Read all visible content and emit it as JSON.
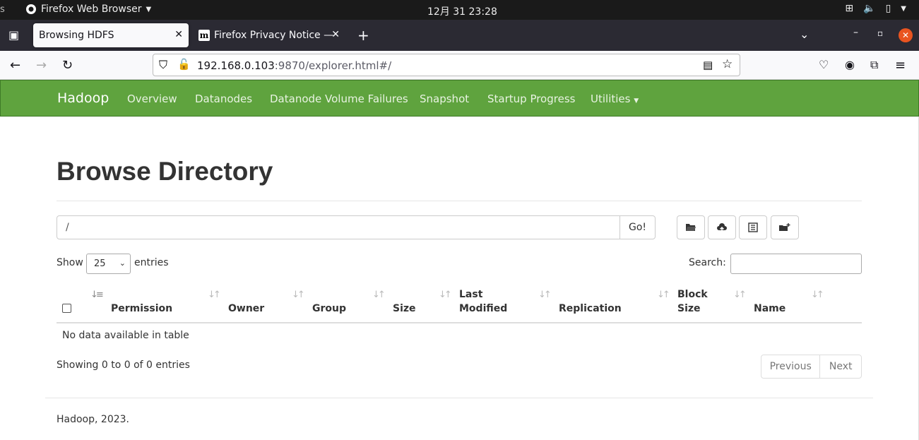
{
  "os": {
    "app_name": "Firefox Web Browser",
    "clock": "12月 31  23:28",
    "left_mark": "s"
  },
  "browser": {
    "tabs": [
      {
        "label": "Browsing HDFS"
      },
      {
        "label": "Firefox Privacy Notice —"
      }
    ],
    "url_host": "192.168.0.103",
    "url_rest": ":9870/explorer.html#/"
  },
  "hadoop_nav": {
    "brand": "Hadoop",
    "links": [
      "Overview",
      "Datanodes",
      "Datanode Volume Failures",
      "Snapshot",
      "Startup Progress",
      "Utilities"
    ]
  },
  "page": {
    "title": "Browse Directory",
    "path_value": "/",
    "go_label": "Go!",
    "show_label": "Show",
    "entries_value": "25",
    "entries_label": "entries",
    "search_label": "Search:",
    "columns": {
      "permission": "Permission",
      "owner": "Owner",
      "group": "Group",
      "size": "Size",
      "last_modified_1": "Last",
      "last_modified_2": "Modified",
      "replication": "Replication",
      "block_size_1": "Block",
      "block_size_2": "Size",
      "name": "Name"
    },
    "no_data": "No data available in table",
    "showing": "Showing 0 to 0 of 0 entries",
    "prev_label": "Previous",
    "next_label": "Next",
    "footer": "Hadoop, 2023."
  }
}
